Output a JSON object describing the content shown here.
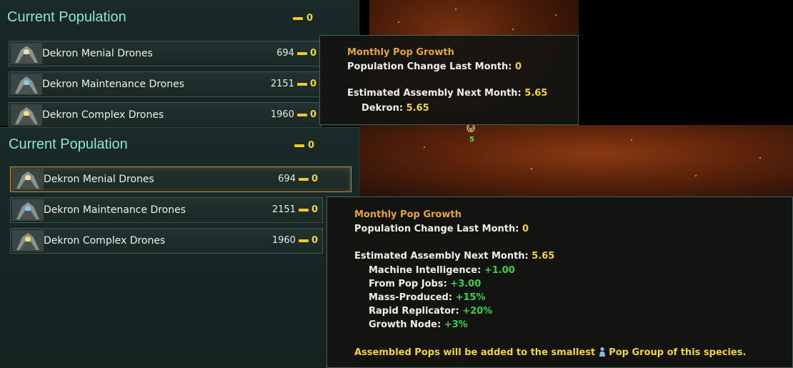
{
  "panels": [
    {
      "title": "Current Population",
      "total_growth": "0",
      "rows": [
        {
          "label": "Dekron Menial Drones",
          "count": "694",
          "growth": "0",
          "selected": false
        },
        {
          "label": "Dekron Maintenance Drones",
          "count": "2151",
          "growth": "0",
          "selected": false
        },
        {
          "label": "Dekron Complex Drones",
          "count": "1960",
          "growth": "0",
          "selected": false
        }
      ]
    },
    {
      "title": "Current Population",
      "total_growth": "0",
      "rows": [
        {
          "label": "Dekron Menial Drones",
          "count": "694",
          "growth": "0",
          "selected": true
        },
        {
          "label": "Dekron Maintenance Drones",
          "count": "2151",
          "growth": "0",
          "selected": false
        },
        {
          "label": "Dekron Complex Drones",
          "count": "1960",
          "growth": "0",
          "selected": false
        }
      ]
    }
  ],
  "tooltip_small": {
    "heading": "Monthly Pop Growth",
    "change_label": "Population Change Last Month:",
    "change_value": "0",
    "assembly_label": "Estimated Assembly Next Month:",
    "assembly_value": "5.65",
    "sub_label": "Dekron:",
    "sub_value": "5.65"
  },
  "tooltip_large": {
    "heading": "Monthly Pop Growth",
    "change_label": "Population Change Last Month:",
    "change_value": "0",
    "assembly_label": "Estimated Assembly Next Month:",
    "assembly_value": "5.65",
    "modifiers": [
      {
        "label": "Machine Intelligence:",
        "value": "+1.00"
      },
      {
        "label": "From Pop Jobs:",
        "value": "+3.00"
      },
      {
        "label": "Mass-Produced:",
        "value": "+15%"
      },
      {
        "label": "Rapid Replicator:",
        "value": "+20%"
      },
      {
        "label": "Growth Node:",
        "value": "+3%"
      }
    ],
    "footer_before": "Assembled Pops will be added to the smallest",
    "footer_after": "Pop Group of this species."
  },
  "map": {
    "system_pop_count": "5"
  },
  "colors": {
    "accent_title": "#8fe6c6",
    "heading": "#e6a53a",
    "value": "#f2d43a",
    "positive": "#3ad24a"
  }
}
